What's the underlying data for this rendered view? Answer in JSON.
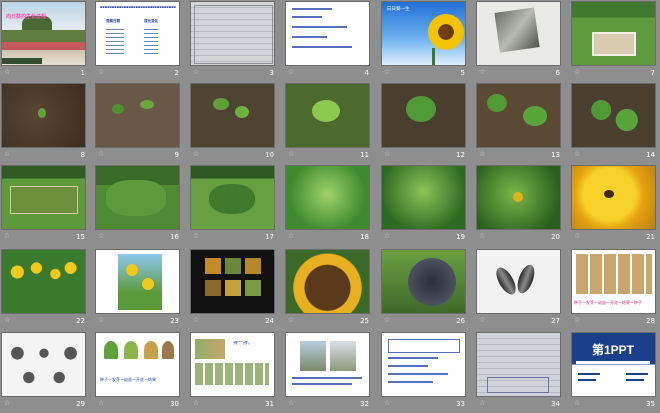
{
  "slides": [
    {
      "num": "1",
      "caption": "向日葵的生长过程"
    },
    {
      "num": "2",
      "heading_left": "观察日期",
      "heading_right": "成长变化"
    },
    {
      "num": "3"
    },
    {
      "num": "4"
    },
    {
      "num": "5",
      "caption": "向日葵一生"
    },
    {
      "num": "6"
    },
    {
      "num": "7"
    },
    {
      "num": "8"
    },
    {
      "num": "9"
    },
    {
      "num": "10"
    },
    {
      "num": "11"
    },
    {
      "num": "12"
    },
    {
      "num": "13"
    },
    {
      "num": "14"
    },
    {
      "num": "15"
    },
    {
      "num": "16"
    },
    {
      "num": "17"
    },
    {
      "num": "18"
    },
    {
      "num": "19"
    },
    {
      "num": "20"
    },
    {
      "num": "21"
    },
    {
      "num": "22"
    },
    {
      "num": "23"
    },
    {
      "num": "24"
    },
    {
      "num": "25"
    },
    {
      "num": "26"
    },
    {
      "num": "27"
    },
    {
      "num": "28",
      "caption": "种子—发芽—幼苗—开花—结果—种子"
    },
    {
      "num": "29"
    },
    {
      "num": "30",
      "caption": "种子—发芽—幼苗—开花—结果"
    },
    {
      "num": "31",
      "caption": "排一排。"
    },
    {
      "num": "32"
    },
    {
      "num": "33"
    },
    {
      "num": "34"
    },
    {
      "num": "35",
      "logo": "第1PPT"
    }
  ],
  "star_glyph": "☆"
}
